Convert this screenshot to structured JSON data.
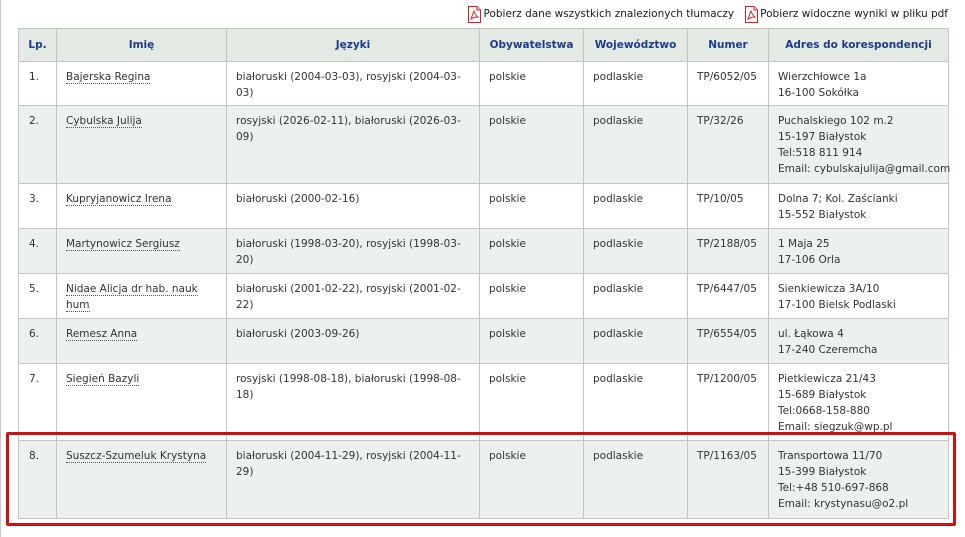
{
  "downloads": {
    "all_label": "Pobierz dane wszystkich znalezionych tłumaczy",
    "visible_label": "Pobierz widoczne wyniki w pliku pdf",
    "icon": "pdf-file-icon",
    "icon_color": "#cc2222"
  },
  "table": {
    "headers": [
      "Lp.",
      "Imię",
      "Języki",
      "Obywatelstwa",
      "Województwo",
      "Numer",
      "Adres do korespondencji"
    ],
    "rows": [
      {
        "lp": "1.",
        "name": "Bajerska Regina",
        "languages": "białoruski (2004-03-03), rosyjski (2004-03-03)",
        "citizenship": "polskie",
        "voivodeship": "podlaskie",
        "number": "TP/6052/05",
        "address": [
          "Wierzchłowce 1a",
          "16-100 Sokółka"
        ]
      },
      {
        "lp": "2.",
        "name": "Cybulska Julija",
        "languages": "rosyjski (2026-02-11), białoruski (2026-03-09)",
        "citizenship": "polskie",
        "voivodeship": "podlaskie",
        "number": "TP/32/26",
        "address": [
          "Puchalskiego 102 m.2",
          "15-197 Białystok",
          "Tel:518 811 914",
          "Email: cybulskajulija@gmail.com"
        ]
      },
      {
        "lp": "3.",
        "name": "Kupryjanowicz Irena",
        "languages": "białoruski (2000-02-16)",
        "citizenship": "polskie",
        "voivodeship": "podlaskie",
        "number": "TP/10/05",
        "address": [
          "Dolna 7; Kol. Zaścianki",
          "15-552 Białystok"
        ]
      },
      {
        "lp": "4.",
        "name": "Martynowicz Sergiusz",
        "languages": "białoruski (1998-03-20), rosyjski (1998-03-20)",
        "citizenship": "polskie",
        "voivodeship": "podlaskie",
        "number": "TP/2188/05",
        "address": [
          "1 Maja 25",
          "17-106 Orla"
        ]
      },
      {
        "lp": "5.",
        "name": "Nidae Alicja dr hab. nauk hum",
        "languages": "białoruski (2001-02-22), rosyjski (2001-02-22)",
        "citizenship": "polskie",
        "voivodeship": "podlaskie",
        "number": "TP/6447/05",
        "address": [
          "Sienkiewicza 3A/10",
          "17-100 Bielsk Podlaski"
        ]
      },
      {
        "lp": "6.",
        "name": "Remesz Anna",
        "languages": "białoruski (2003-09-26)",
        "citizenship": "polskie",
        "voivodeship": "podlaskie",
        "number": "TP/6554/05",
        "address": [
          "ul. Łąkowa 4",
          "17-240 Czeremcha"
        ]
      },
      {
        "lp": "7.",
        "name": "Siegień Bazyli",
        "languages": "rosyjski (1998-08-18), białoruski (1998-08-18)",
        "citizenship": "polskie",
        "voivodeship": "podlaskie",
        "number": "TP/1200/05",
        "address": [
          "Pietkiewicza 21/43",
          "15-689 Białystok",
          "Tel:0668-158-880",
          "Email: siegzuk@wp.pl"
        ]
      },
      {
        "lp": "8.",
        "name": "Suszcz-Szumeluk Krystyna",
        "languages": "białoruski (2004-11-29), rosyjski (2004-11-29)",
        "citizenship": "polskie",
        "voivodeship": "podlaskie",
        "number": "TP/1163/05",
        "address": [
          "Transportowa 11/70",
          "15-399 Białystok",
          "Tel:+48 510-697-868",
          "Email: krystynasu@o2.pl"
        ]
      }
    ]
  },
  "colors": {
    "header_bg": "#e3e9e3",
    "header_text": "#1d3d8a",
    "alt_row_bg": "#edf1ed",
    "highlight_border": "#cc1111"
  }
}
